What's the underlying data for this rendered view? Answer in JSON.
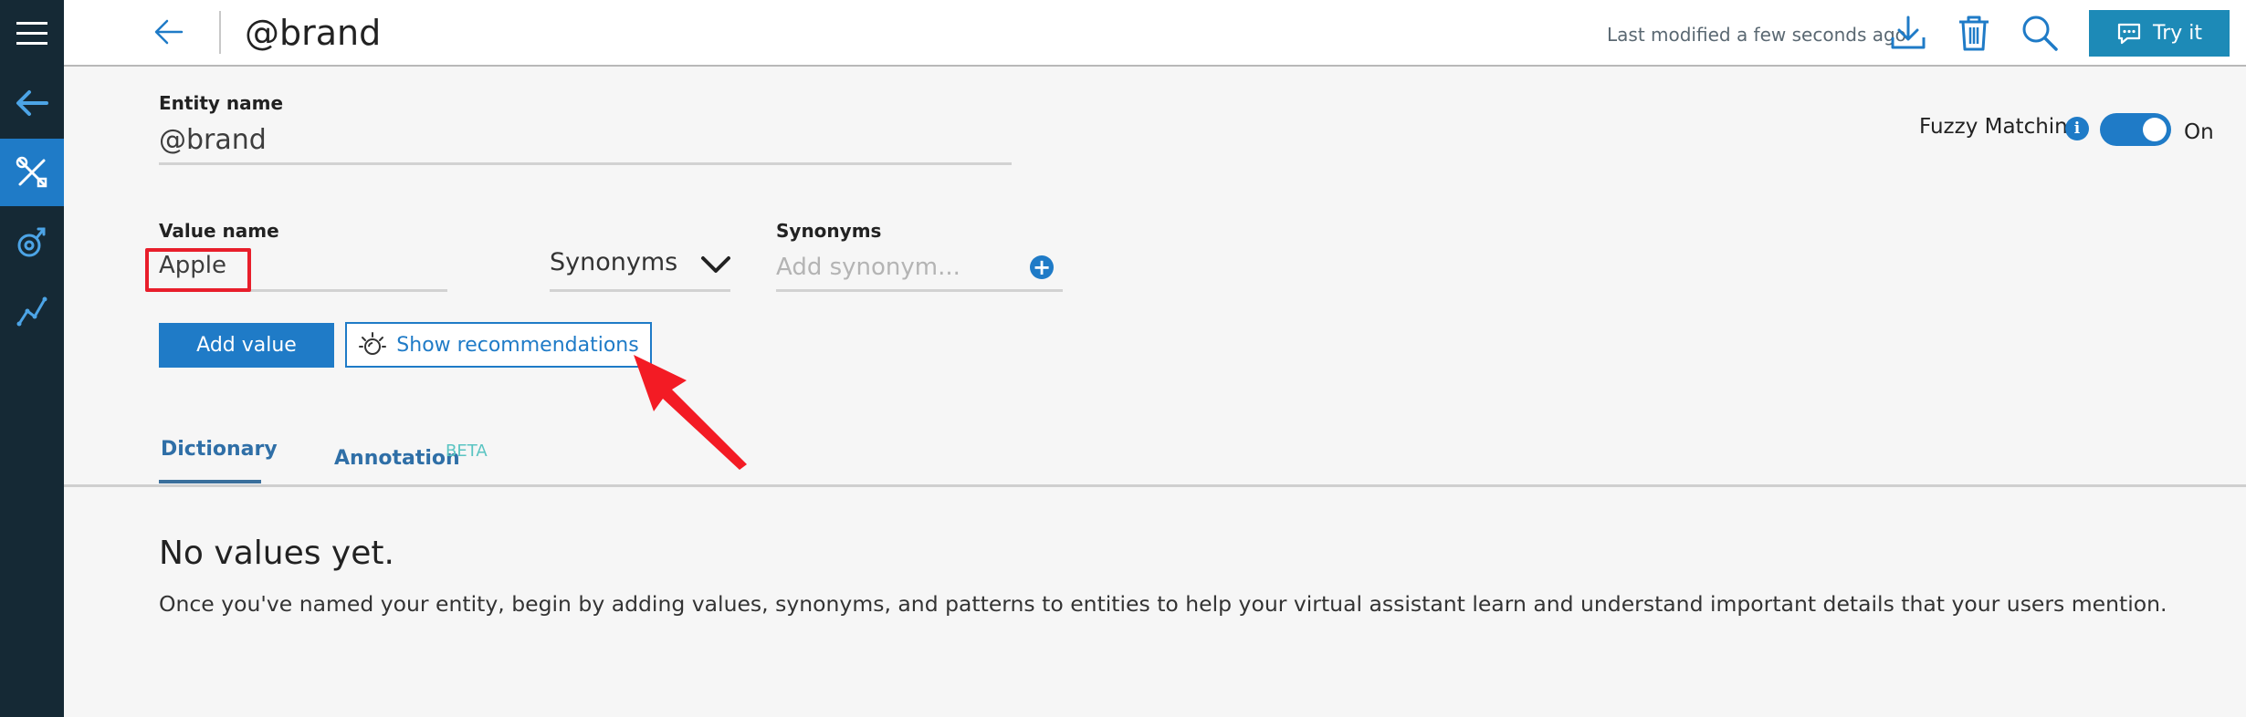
{
  "header": {
    "title": "@brand",
    "last_modified": "Last modified a few seconds ago",
    "try_it_label": "Try it"
  },
  "form": {
    "entity_name_label": "Entity name",
    "entity_name_value": "@brand",
    "value_name_label": "Value name",
    "value_name_value": "Apple",
    "type_select_value": "Synonyms",
    "synonyms_label": "Synonyms",
    "synonyms_placeholder": "Add synonym...",
    "add_value_label": "Add value",
    "show_recommendations_label": "Show recommendations"
  },
  "fuzzy": {
    "label": "Fuzzy Matching",
    "info_glyph": "i",
    "state": "On"
  },
  "tabs": [
    {
      "label": "Dictionary",
      "active": true
    },
    {
      "label": "Annotation",
      "badge": "BETA"
    }
  ],
  "empty_state": {
    "title": "No values yet.",
    "description": "Once you've named your entity, begin by adding values, synonyms, and patterns to entities to help your virtual assistant learn and understand important details that your users mention."
  },
  "icons": {
    "nav": [
      "menu-icon",
      "back-arrow-icon",
      "tools-icon",
      "intent-icon",
      "analytics-icon"
    ],
    "header": [
      "back-arrow-icon",
      "download-icon",
      "trash-icon",
      "search-icon",
      "chat-icon"
    ]
  },
  "colors": {
    "nav_bg": "#152935",
    "accent": "#1f7bc7",
    "try_it_bg": "#1d8ab7",
    "highlight": "#e81e2b",
    "beta": "#5ac4c2"
  }
}
